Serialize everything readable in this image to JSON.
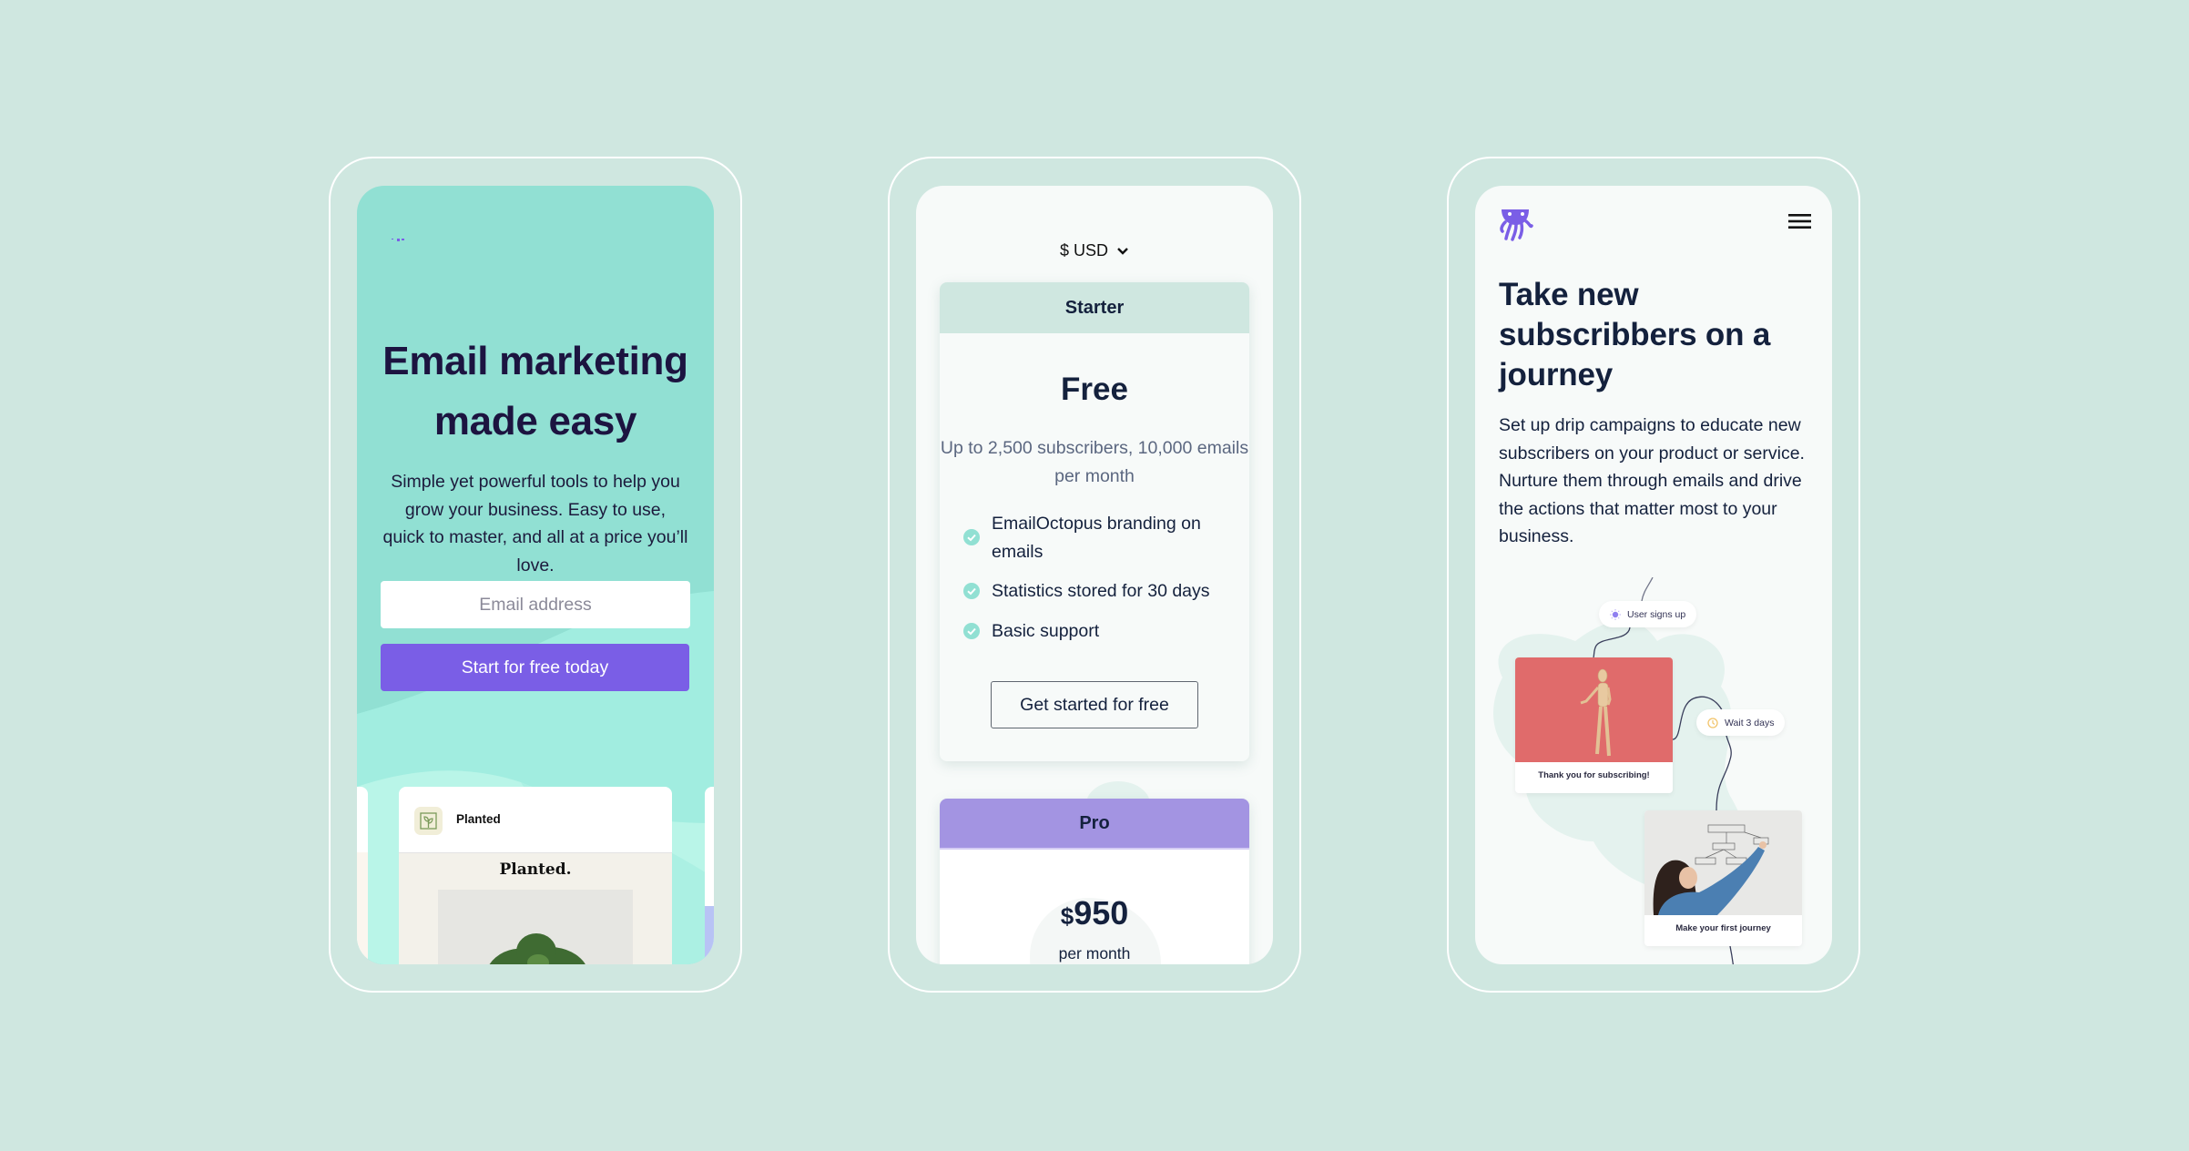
{
  "theme": {
    "background": "#cfe7e0",
    "brand_purple": "#7a5ee6",
    "hero_teal": "#91e0d3",
    "starter_header": "#cfe7e0",
    "pro_header": "#a394e2",
    "check_green": "#91e0d3"
  },
  "phone1": {
    "logo_icon": "emailoctopus-logo-icon",
    "hero": {
      "title": "Email marketing made easy",
      "subtitle": "Simple yet powerful tools to help you grow your business. Easy to use, quick to master, and all at a price you’ll love."
    },
    "signup_form": {
      "email_placeholder": "Email address",
      "email_value": "",
      "submit_label": "Start for free today"
    },
    "template_carousel": {
      "active_card": {
        "brand_name": "Planted",
        "brand_icon": "plant-icon",
        "email_heading": "Planted."
      }
    }
  },
  "phone2": {
    "currency_selector": {
      "selected": "$ USD",
      "icon": "chevron-down-icon"
    },
    "plans": [
      {
        "name": "Starter",
        "price": "Free",
        "limits": "Up to 2,500 subscribers, 10,000 emails per month",
        "features": [
          "EmailOctopus branding on emails",
          "Statistics stored for 30 days",
          "Basic support"
        ],
        "button_label": "Get started for free"
      },
      {
        "name": "Pro",
        "currency_symbol": "$",
        "price": "950",
        "period": "per month"
      }
    ]
  },
  "phone3": {
    "logo_icon": "emailoctopus-logo-icon",
    "menu_icon": "hamburger-menu-icon",
    "title": "Take new subscribbers on a journey",
    "body": "Set up drip campaigns to educate new subscribers on your product or service. Nurture them through emails and drive the actions that matter most to your business.",
    "journey": {
      "trigger": {
        "label": "User signs up",
        "icon": "sparkle-icon"
      },
      "steps": [
        {
          "caption": "Thank you for subscribing!"
        },
        {
          "delay": "Wait 3 days",
          "icon": "clock-icon"
        },
        {
          "caption": "Make your first journey"
        }
      ]
    }
  }
}
